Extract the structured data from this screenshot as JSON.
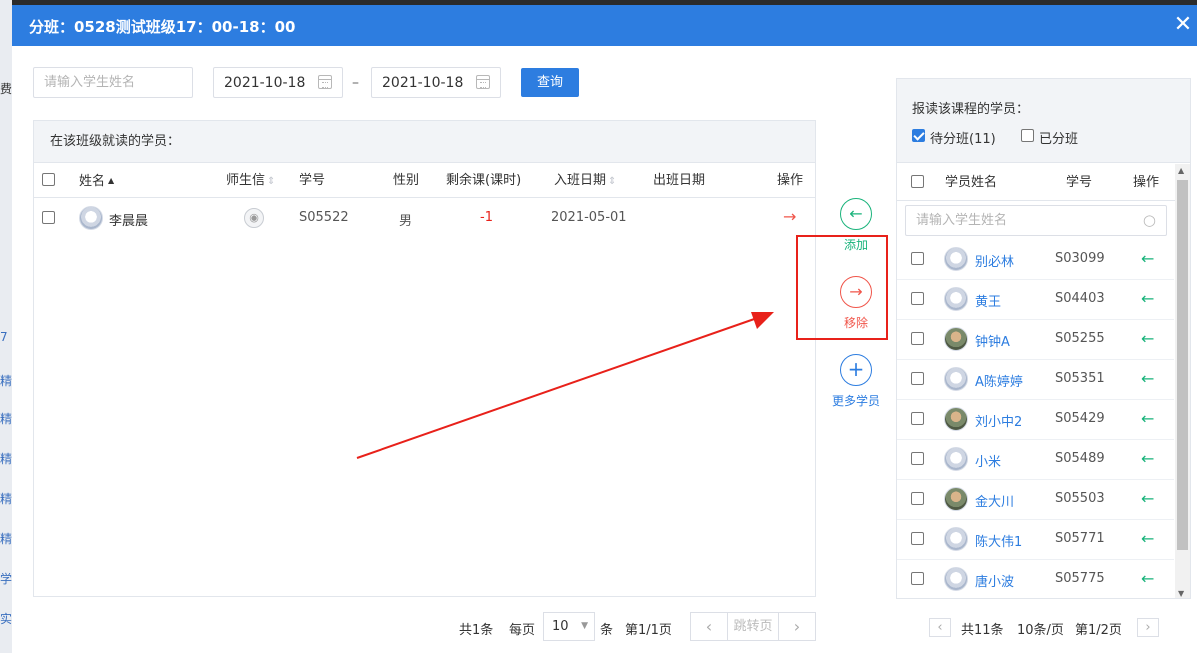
{
  "background": {
    "fragments": [
      "费",
      "7",
      "精",
      "精",
      "精",
      "精",
      "精",
      "学",
      "实"
    ]
  },
  "modal": {
    "title": "分班：0528测试班级17：00-18：00",
    "close_icon": "close-icon"
  },
  "filters": {
    "name_placeholder": "请输入学生姓名",
    "date_from": "2021-10-18",
    "date_to": "2021-10-18",
    "date_separator": "–",
    "query_label": "查询"
  },
  "left_panel": {
    "title": "在该班级就读的学员：",
    "columns": [
      "姓名",
      "师生信",
      "学号",
      "性别",
      "剩余课(课时)",
      "入班日期",
      "出班日期",
      "操作"
    ],
    "rows": [
      {
        "name": "李晨晨",
        "student_id": "S05522",
        "gender": "男",
        "remaining": "-1",
        "join_date": "2021-05-01",
        "leave_date": ""
      }
    ],
    "pager": {
      "total": "共1条",
      "per_page_label": "每页",
      "per_page_value": "10",
      "unit": "条",
      "page": "第1/1页",
      "jump": "跳转页"
    }
  },
  "middle_actions": {
    "add_label": "添加",
    "remove_label": "移除",
    "more_label": "更多学员"
  },
  "right_panel": {
    "title": "报读该课程的学员：",
    "filter_pending": "待分班(11)",
    "filter_assigned": "已分班",
    "pending_checked": true,
    "columns": [
      "学员姓名",
      "学号",
      "操作"
    ],
    "search_placeholder": "请输入学生姓名",
    "rows": [
      {
        "name": "别必林",
        "student_id": "S03099",
        "avatar": "default"
      },
      {
        "name": "黄王",
        "student_id": "S04403",
        "avatar": "default"
      },
      {
        "name": "钟钟A",
        "student_id": "S05255",
        "avatar": "photo"
      },
      {
        "name": "A陈婷婷",
        "student_id": "S05351",
        "avatar": "default"
      },
      {
        "name": "刘小中2",
        "student_id": "S05429",
        "avatar": "photo"
      },
      {
        "name": "小米",
        "student_id": "S05489",
        "avatar": "default"
      },
      {
        "name": "金大川",
        "student_id": "S05503",
        "avatar": "photo"
      },
      {
        "name": "陈大伟1",
        "student_id": "S05771",
        "avatar": "default"
      },
      {
        "name": "唐小波",
        "student_id": "S05775",
        "avatar": "default"
      }
    ],
    "pager": {
      "total": "共11条",
      "per_page": "10条/页",
      "page": "第1/2页"
    }
  },
  "colors": {
    "primary": "#2d7de0",
    "add_green": "#19b37b",
    "remove_red": "#f0554a",
    "annotation_red": "#e8211a"
  }
}
